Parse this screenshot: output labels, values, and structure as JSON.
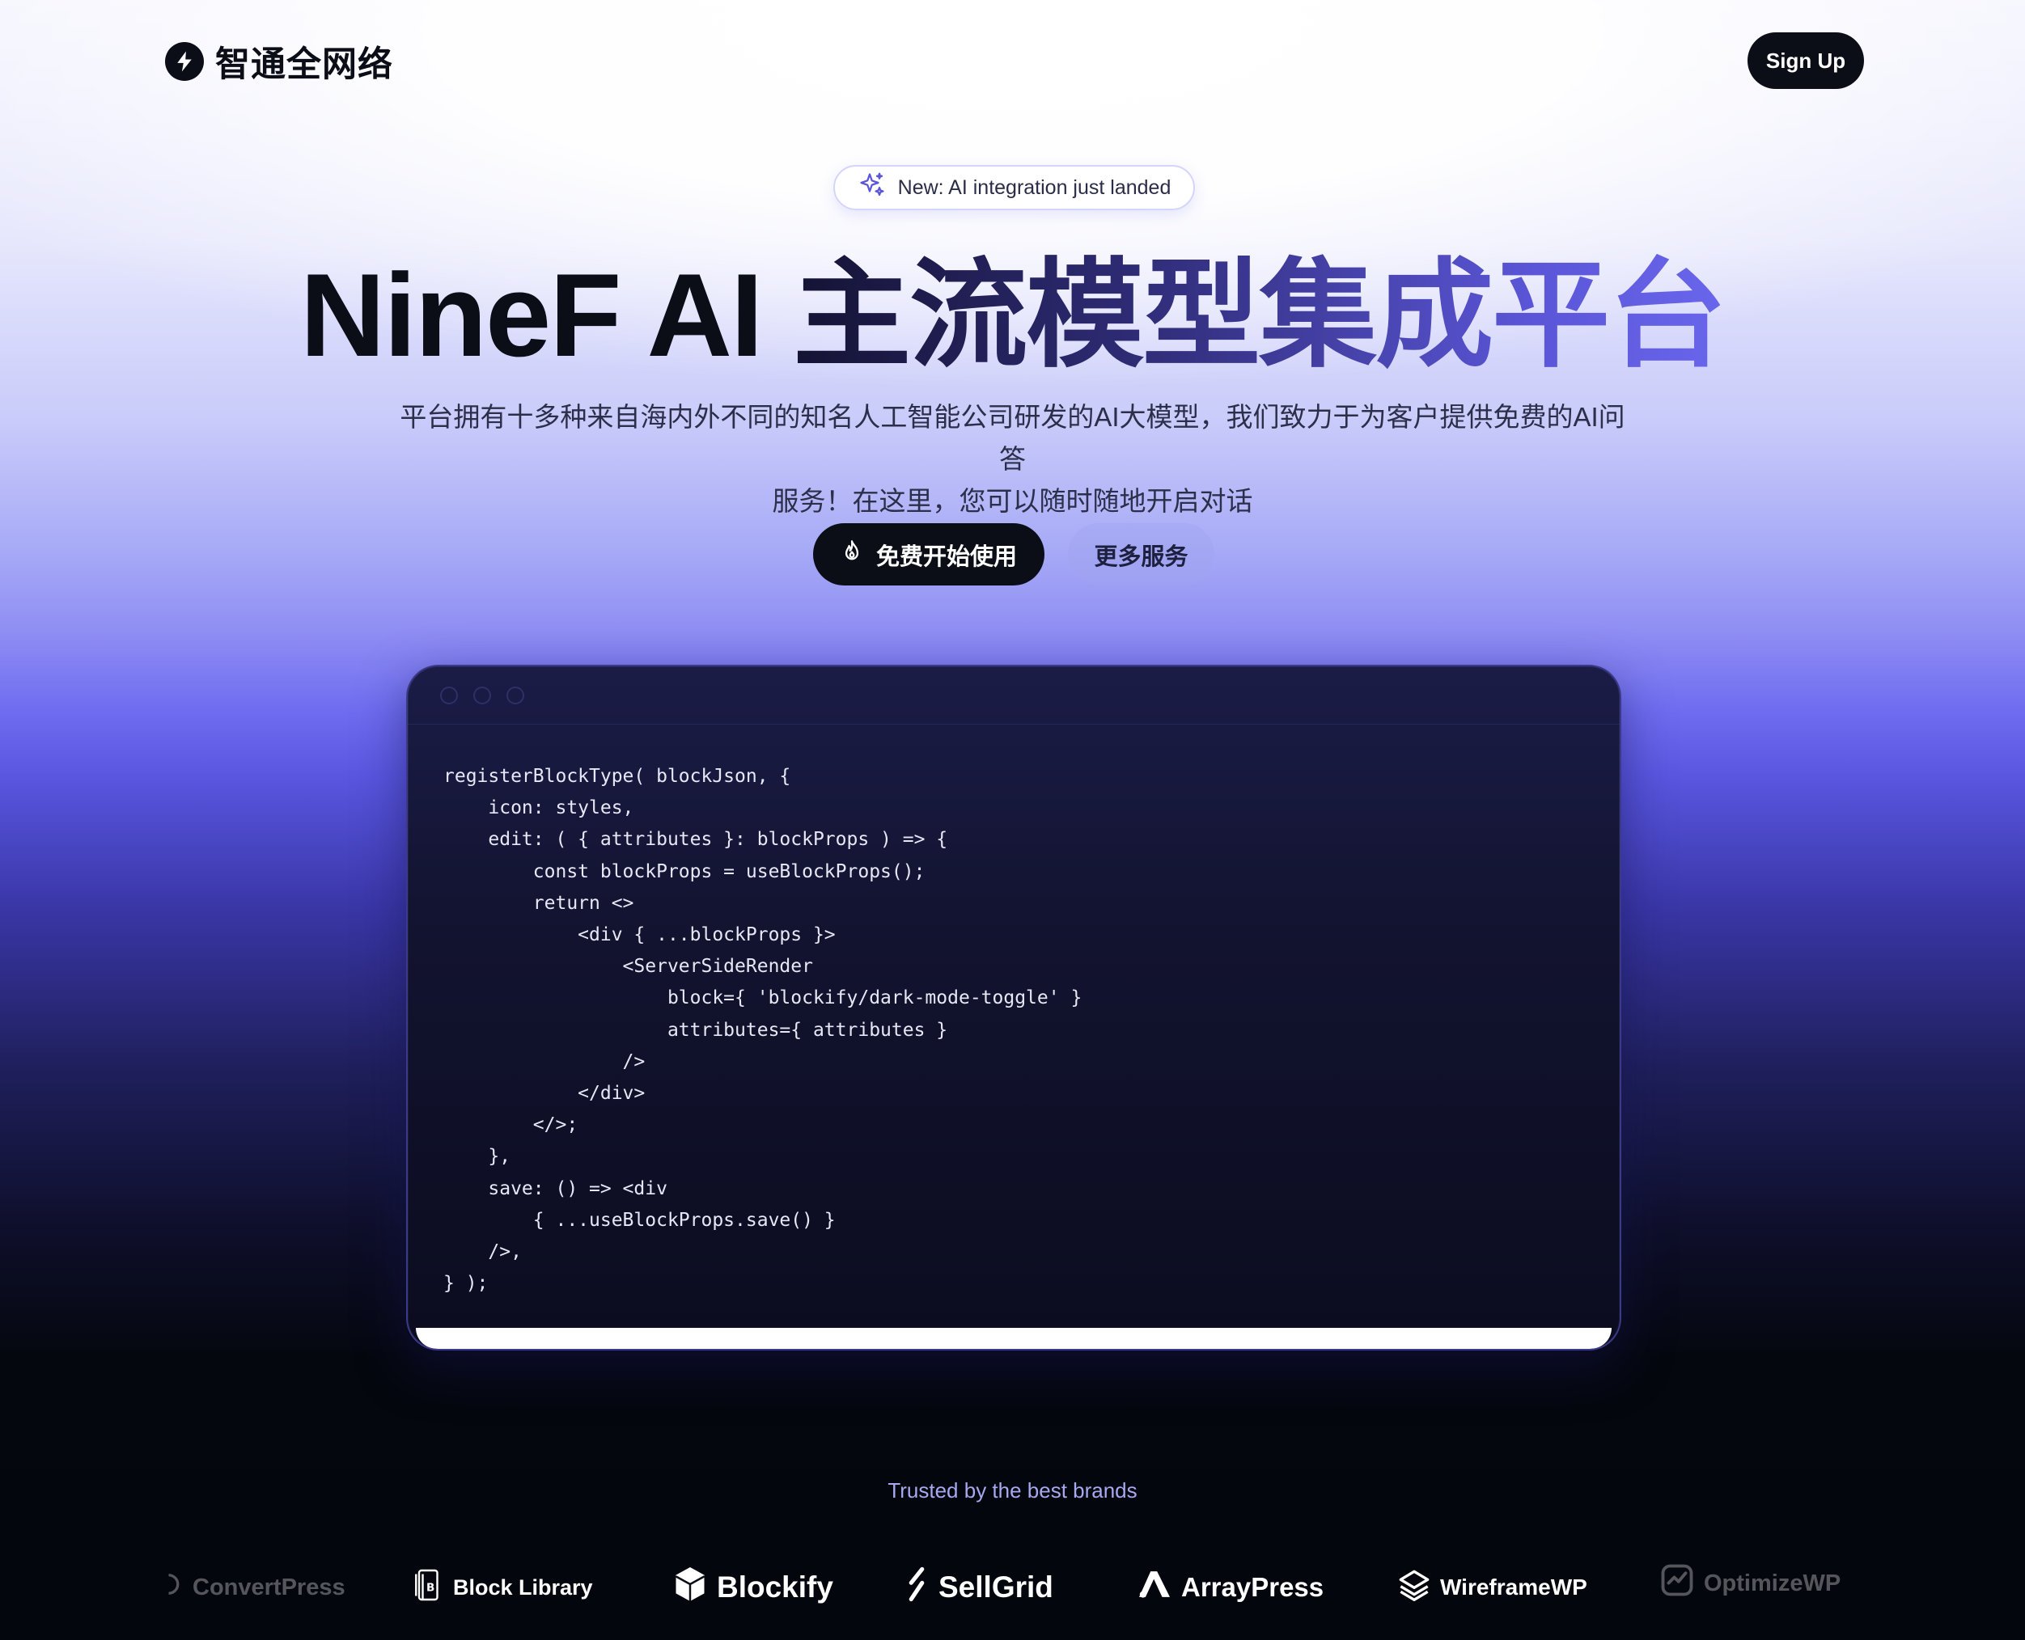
{
  "header": {
    "brand_name": "智通全网络",
    "signup_label": "Sign Up"
  },
  "hero": {
    "badge_text": "New: AI integration just landed",
    "headline_part1": "NineF AI ",
    "headline_part2": "主流模型集成平台",
    "subtitle_line1": "平台拥有十多种来自海内外不同的知名人工智能公司研发的AI大模型，我们致力于为客户提供免费的AI问答",
    "subtitle_line2": "服务！在这里，您可以随时随地开启对话",
    "cta_primary_label": "免费开始使用",
    "cta_secondary_label": "更多服务"
  },
  "code_window": {
    "code": "registerBlockType( blockJson, {\n    icon: styles,\n    edit: ( { attributes }: blockProps ) => {\n        const blockProps = useBlockProps();\n        return <>\n            <div { ...blockProps }>\n                <ServerSideRender\n                    block={ 'blockify/dark-mode-toggle' }\n                    attributes={ attributes }\n                />\n            </div>\n        </>;\n    },\n    save: () => <div\n        { ...useBlockProps.save() }\n    />,\n} );"
  },
  "trusted": {
    "label": "Trusted by the best brands",
    "logos": [
      {
        "name": "ConvertPress",
        "icon": "convertpress-icon"
      },
      {
        "name": "Block Library",
        "icon": "block-library-icon"
      },
      {
        "name": "Blockify",
        "icon": "blockify-icon"
      },
      {
        "name": "SellGrid",
        "icon": "sellgrid-icon"
      },
      {
        "name": "ArrayPress",
        "icon": "arraypress-icon"
      },
      {
        "name": "WireframeWP",
        "icon": "wireframewp-icon"
      },
      {
        "name": "OptimizeWP",
        "icon": "optimizewp-icon"
      }
    ]
  },
  "colors": {
    "primary_dark": "#0b0d17",
    "accent": "#5b56d8",
    "trusted_text": "#a6a8f0"
  }
}
